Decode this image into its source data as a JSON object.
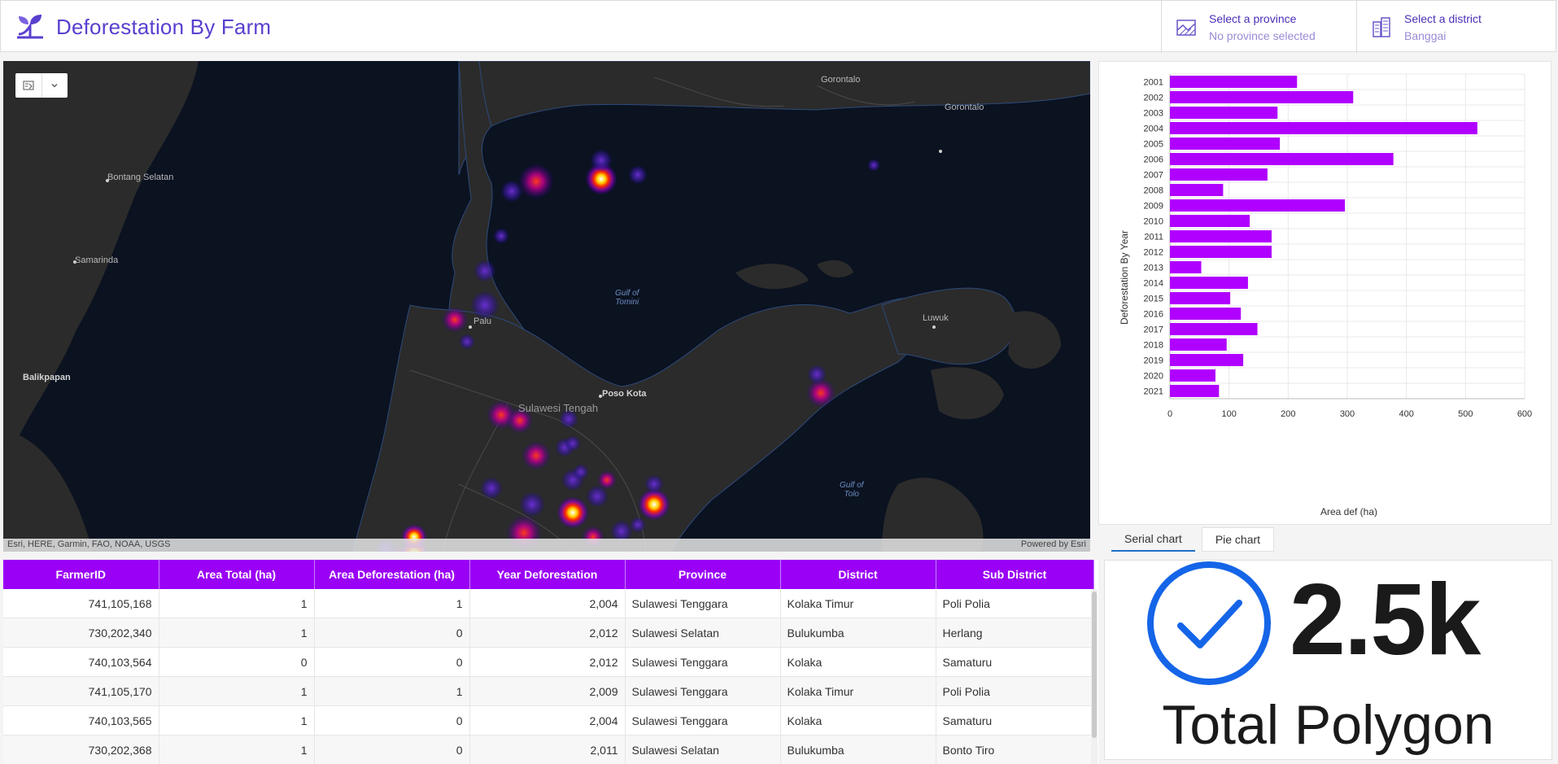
{
  "header": {
    "title": "Deforestation By Farm",
    "province": {
      "title": "Select a province",
      "value": "No province selected"
    },
    "district": {
      "title": "Select a district",
      "value": "Banggai"
    }
  },
  "map": {
    "labels": {
      "gorontalo_1": "Gorontalo",
      "gorontalo_2": "Gorontalo",
      "bontang": "Bontang Selatan",
      "samarinda": "Samarinda",
      "balikpapan": "Balikpapan",
      "palu": "Palu",
      "gulf_tomini_1": "Gulf of",
      "gulf_tomini_2": "Tomini",
      "luwuk": "Luwuk",
      "poso": "Poso Kota",
      "sulteng": "Sulawesi Tengah",
      "gulf_tolo_1": "Gulf of",
      "gulf_tolo_2": "Tolo"
    },
    "attribution_left": "Esri, HERE, Garmin, FAO, NOAA, USGS",
    "attribution_right": "Powered by Esri",
    "toolbar_icons": [
      "layer-list-icon",
      "chevron-down-icon"
    ]
  },
  "chart_data": {
    "type": "bar",
    "orientation": "horizontal",
    "categories": [
      "2001",
      "2002",
      "2003",
      "2004",
      "2005",
      "2006",
      "2007",
      "2008",
      "2009",
      "2010",
      "2011",
      "2012",
      "2013",
      "2014",
      "2015",
      "2016",
      "2017",
      "2018",
      "2019",
      "2020",
      "2021"
    ],
    "values": [
      215,
      310,
      182,
      520,
      186,
      378,
      165,
      90,
      296,
      135,
      172,
      172,
      53,
      132,
      102,
      120,
      148,
      96,
      124,
      77,
      83
    ],
    "xlabel": "Area def (ha)",
    "ylabel": "Deforestation By Year",
    "xlim": [
      0,
      600
    ],
    "xticks": [
      "0",
      "100",
      "200",
      "300",
      "400",
      "500",
      "600"
    ],
    "color": "#b000ff",
    "grid": true
  },
  "tabs": [
    {
      "label": "Serial chart",
      "active": true
    },
    {
      "label": "Pie chart",
      "active": false
    }
  ],
  "table": {
    "columns": [
      "FarmerID",
      "Area Total (ha)",
      "Area Deforestation (ha)",
      "Year Deforestation",
      "Province",
      "District",
      "Sub District"
    ],
    "rows": [
      [
        "741,105,168",
        "1",
        "1",
        "2,004",
        "Sulawesi Tenggara",
        "Kolaka Timur",
        "Poli Polia"
      ],
      [
        "730,202,340",
        "1",
        "0",
        "2,012",
        "Sulawesi Selatan",
        "Bulukumba",
        "Herlang"
      ],
      [
        "740,103,564",
        "0",
        "0",
        "2,012",
        "Sulawesi Tenggara",
        "Kolaka",
        "Samaturu"
      ],
      [
        "741,105,170",
        "1",
        "1",
        "2,009",
        "Sulawesi Tenggara",
        "Kolaka Timur",
        "Poli Polia"
      ],
      [
        "740,103,565",
        "1",
        "0",
        "2,004",
        "Sulawesi Tenggara",
        "Kolaka",
        "Samaturu"
      ],
      [
        "730,202,368",
        "1",
        "0",
        "2,011",
        "Sulawesi Selatan",
        "Bulukumba",
        "Bonto Tiro"
      ]
    ]
  },
  "indicator": {
    "value": "2.5k",
    "label": "Total Polygon",
    "icon": "check-circle-icon",
    "icon_color": "#1565e8"
  },
  "colors": {
    "brand": "#5a3fd0",
    "table_header": "#9a00f5",
    "bar": "#b000ff",
    "map_water": "#0b1220",
    "map_land": "#2b2b2b"
  }
}
